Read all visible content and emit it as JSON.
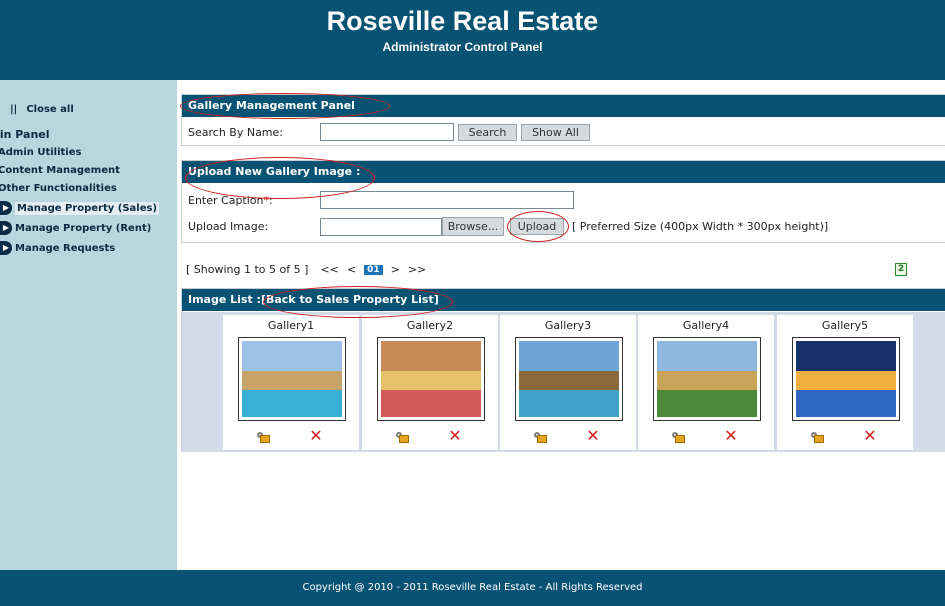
{
  "header": {
    "title": "Roseville Real Estate",
    "subtitle": "Administrator Control Panel"
  },
  "sidebar": {
    "close_all": "Close all",
    "panel_title": "nin Panel",
    "items": [
      "Admin Utilities",
      "Content Management",
      "Other Functionalities"
    ],
    "sub_items": [
      "Manage Property (Sales)",
      "Manage Property (Rent)",
      "Manage Requests"
    ]
  },
  "gallery_panel": {
    "heading": "Gallery Management Panel",
    "search_label": "Search By Name:",
    "search_value": "",
    "search_button": "Search",
    "show_all_button": "Show All"
  },
  "upload_panel": {
    "heading": "Upload New Gallery Image :",
    "caption_label": "Enter Caption",
    "required_mark": "*",
    "caption_suffix": ":",
    "caption_value": "",
    "image_label": "Upload Image:",
    "browse_button": "Browse...",
    "upload_button": "Upload",
    "size_hint": "[ Preferred Size (400px Width * 300px height)]"
  },
  "pager": {
    "showing": "[ Showing 1 to 5 of 5 ]",
    "first": "<<",
    "prev": "<",
    "current": "01",
    "next": ">",
    "last": ">>"
  },
  "image_list": {
    "heading": "Image List :[Back to Sales Property List]",
    "items": [
      {
        "name": "Gallery1",
        "sky": "#9cc2e8",
        "mid": "#c8a46a",
        "low": "#3ab0d6"
      },
      {
        "name": "Gallery2",
        "sky": "#c58a55",
        "mid": "#e7c06a",
        "low": "#d25a5a"
      },
      {
        "name": "Gallery3",
        "sky": "#6fa6d8",
        "mid": "#8a6a3a",
        "low": "#3fa0c8"
      },
      {
        "name": "Gallery4",
        "sky": "#8fb8e0",
        "mid": "#c9a458",
        "low": "#4c8a3a"
      },
      {
        "name": "Gallery5",
        "sky": "#17306a",
        "mid": "#f0b040",
        "low": "#2e66c2"
      }
    ]
  },
  "footer": {
    "copyright": "Copyright @ 2010 - 2011 Roseville Real Estate - All Rights Reserved"
  }
}
